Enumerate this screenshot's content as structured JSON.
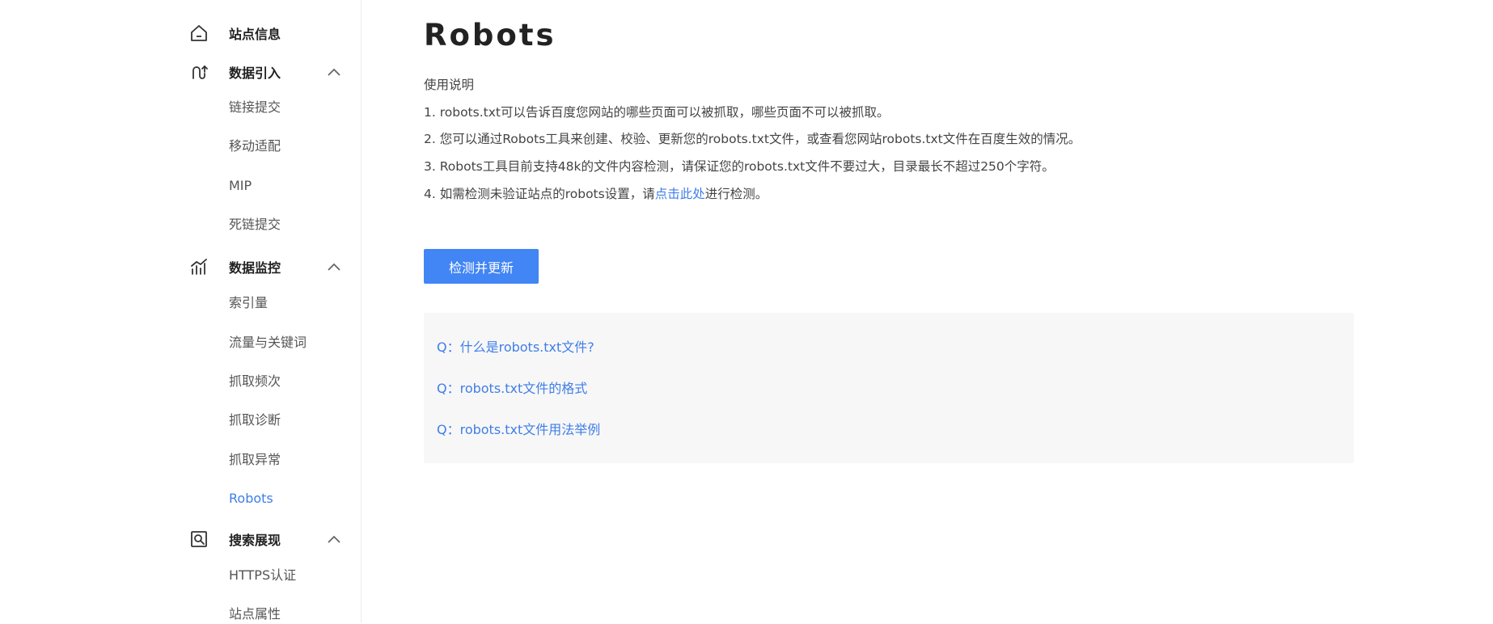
{
  "sidebar": {
    "groups": [
      {
        "icon": "home-icon",
        "label": "站点信息",
        "has_chevron": false,
        "items": []
      },
      {
        "icon": "data-import-icon",
        "label": "数据引入",
        "has_chevron": true,
        "items": [
          "链接提交",
          "移动适配",
          "MIP",
          "死链提交"
        ]
      },
      {
        "icon": "data-monitor-icon",
        "label": "数据监控",
        "has_chevron": true,
        "items": [
          "索引量",
          "流量与关键词",
          "抓取频次",
          "抓取诊断",
          "抓取异常",
          "Robots"
        ]
      },
      {
        "icon": "search-display-icon",
        "label": "搜索展现",
        "has_chevron": true,
        "items": [
          "HTTPS认证",
          "站点属性"
        ]
      }
    ],
    "active_item": "Robots"
  },
  "main": {
    "title": "Robots",
    "usage_heading": "使用说明",
    "lines": [
      "1. robots.txt可以告诉百度您网站的哪些页面可以被抓取，哪些页面不可以被抓取。",
      "2. 您可以通过Robots工具来创建、校验、更新您的robots.txt文件，或查看您网站robots.txt文件在百度生效的情况。",
      "3. Robots工具目前支持48k的文件内容检测，请保证您的robots.txt文件不要过大，目录最长不超过250个字符。"
    ],
    "line4": {
      "prefix": "4. 如需检测未验证站点的robots设置，请",
      "link": "点击此处",
      "suffix": "进行检测。"
    },
    "button_label": "检测并更新",
    "faq": [
      "Q：什么是robots.txt文件?",
      "Q：robots.txt文件的格式",
      "Q：robots.txt文件用法举例"
    ]
  },
  "colors": {
    "accent": "#4285f4",
    "link": "#3f7ee8",
    "faq_background": "#f7f7f7"
  }
}
